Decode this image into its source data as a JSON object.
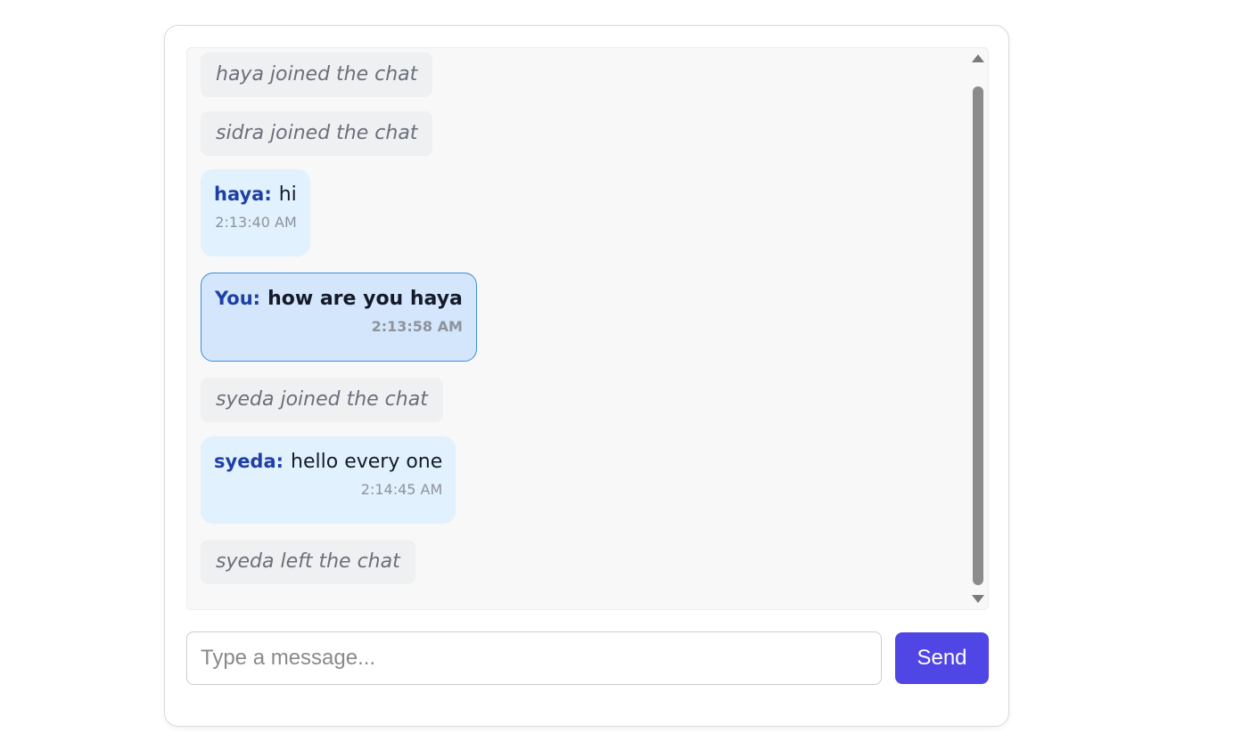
{
  "chat": {
    "messages": [
      {
        "kind": "system",
        "text": "haya joined the chat"
      },
      {
        "kind": "system",
        "text": "sidra joined the chat"
      },
      {
        "kind": "chat",
        "sender": "haya:",
        "text": "hi",
        "time": "2:13:40 AM",
        "own": false
      },
      {
        "kind": "chat",
        "sender": "You:",
        "text": "how are you haya",
        "time": "2:13:58 AM",
        "own": true
      },
      {
        "kind": "system",
        "text": "syeda joined the chat"
      },
      {
        "kind": "chat",
        "sender": "syeda:",
        "text": "hello every one",
        "time": "2:14:45 AM",
        "own": false
      },
      {
        "kind": "system",
        "text": "syeda left the chat"
      }
    ]
  },
  "composer": {
    "placeholder": "Type a message...",
    "value": "",
    "send_label": "Send"
  },
  "colors": {
    "accent": "#4f46e5",
    "sender": "#1f3fa6",
    "bubble": "#e1f1fd",
    "own_bubble": "#d3e6fb",
    "own_border": "#3c8ddb"
  }
}
